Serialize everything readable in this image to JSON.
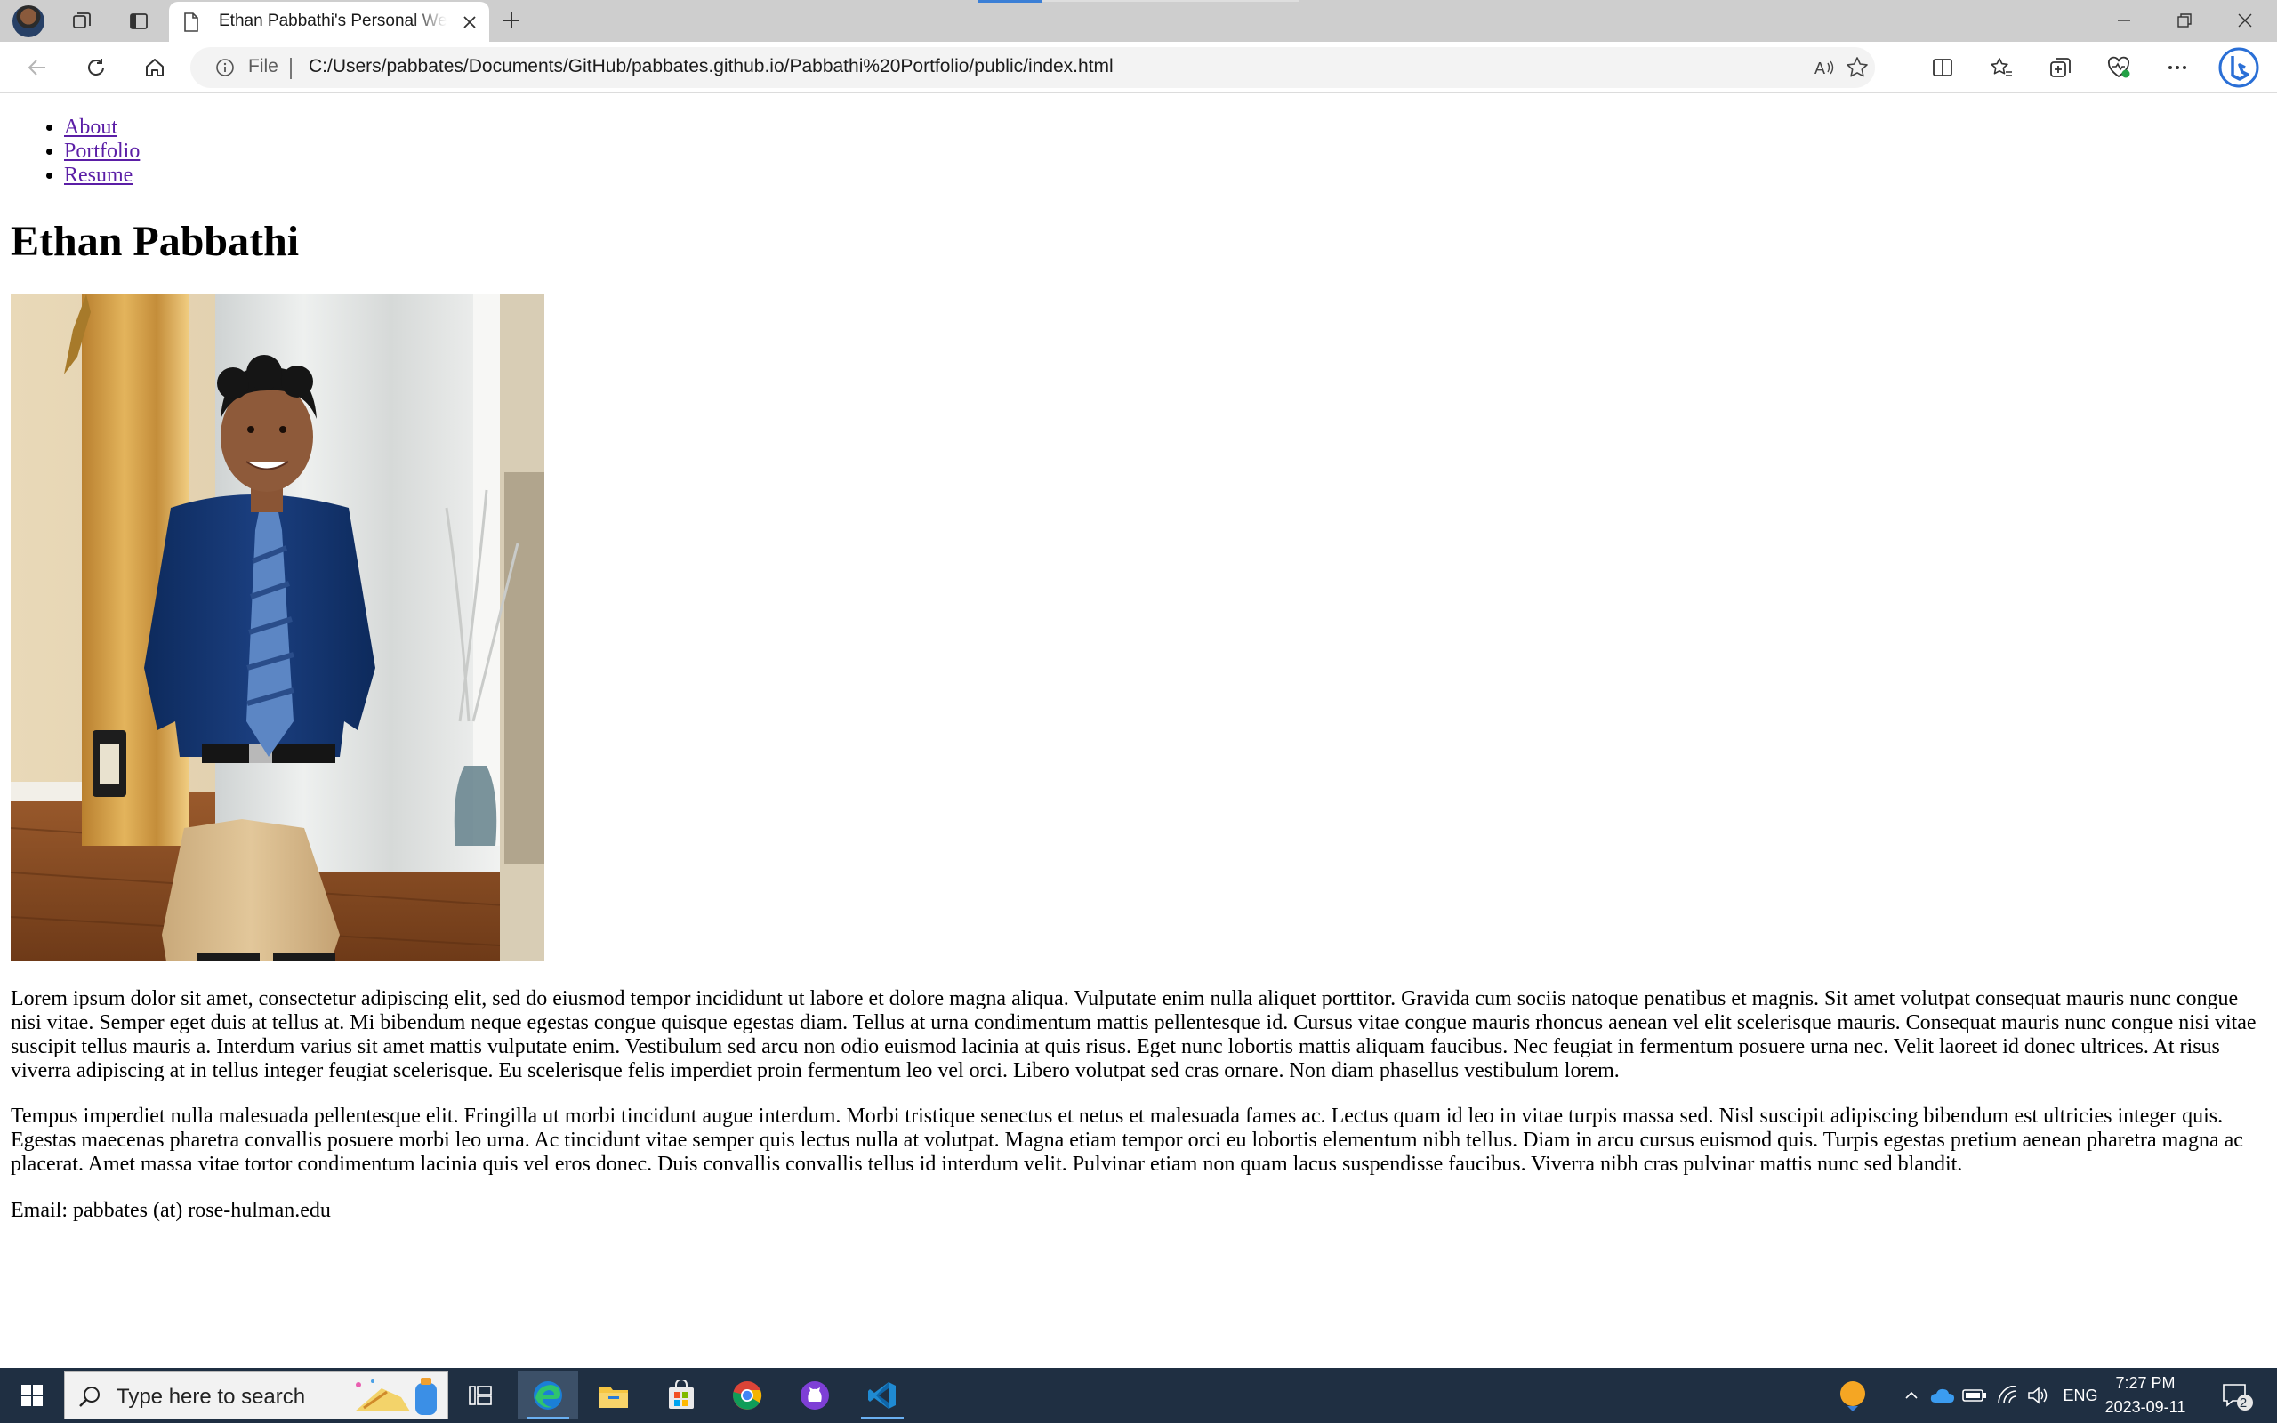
{
  "browser": {
    "tab": {
      "title": "Ethan Pabbathi's Personal Website"
    },
    "address": {
      "scheme": "File",
      "url": "C:/Users/pabbates/Documents/GitHub/pabbates.github.io/Pabbathi%20Portfolio/public/index.html"
    }
  },
  "page": {
    "nav": [
      "About",
      "Portfolio",
      "Resume"
    ],
    "title": "Ethan Pabbathi",
    "paragraphs": [
      "Lorem ipsum dolor sit amet, consectetur adipiscing elit, sed do eiusmod tempor incididunt ut labore et dolore magna aliqua. Vulputate enim nulla aliquet porttitor. Gravida cum sociis natoque penatibus et magnis. Sit amet volutpat consequat mauris nunc congue nisi vitae. Semper eget duis at tellus at. Mi bibendum neque egestas congue quisque egestas diam. Tellus at urna condimentum mattis pellentesque id. Cursus vitae congue mauris rhoncus aenean vel elit scelerisque mauris. Consequat mauris nunc congue nisi vitae suscipit tellus mauris a. Interdum varius sit amet mattis vulputate enim. Vestibulum sed arcu non odio euismod lacinia at quis risus. Eget nunc lobortis mattis aliquam faucibus. Nec feugiat in fermentum posuere urna nec. Velit laoreet id donec ultrices. At risus viverra adipiscing at in tellus integer feugiat scelerisque. Eu scelerisque felis imperdiet proin fermentum leo vel orci. Libero volutpat sed cras ornare. Non diam phasellus vestibulum lorem.",
      "Tempus imperdiet nulla malesuada pellentesque elit. Fringilla ut morbi tincidunt augue interdum. Morbi tristique senectus et netus et malesuada fames ac. Lectus quam id leo in vitae turpis massa sed. Nisl suscipit adipiscing bibendum est ultricies integer quis. Egestas maecenas pharetra convallis posuere morbi leo urna. Ac tincidunt vitae semper quis lectus nulla at volutpat. Magna etiam tempor orci eu lobortis elementum nibh tellus. Diam in arcu cursus euismod quis. Turpis egestas pretium aenean pharetra magna ac placerat. Amet massa vitae tortor condimentum lacinia quis vel eros donec. Duis convallis convallis tellus id interdum velit. Pulvinar etiam non quam lacus suspendisse faucibus. Viverra nibh cras pulvinar mattis nunc sed blandit."
    ],
    "email": "Email: pabbates (at) rose-hulman.edu"
  },
  "taskbar": {
    "search_placeholder": "Type here to search",
    "language": "ENG",
    "time": "7:27 PM",
    "date": "2023-09-11",
    "notification_count": "2"
  }
}
